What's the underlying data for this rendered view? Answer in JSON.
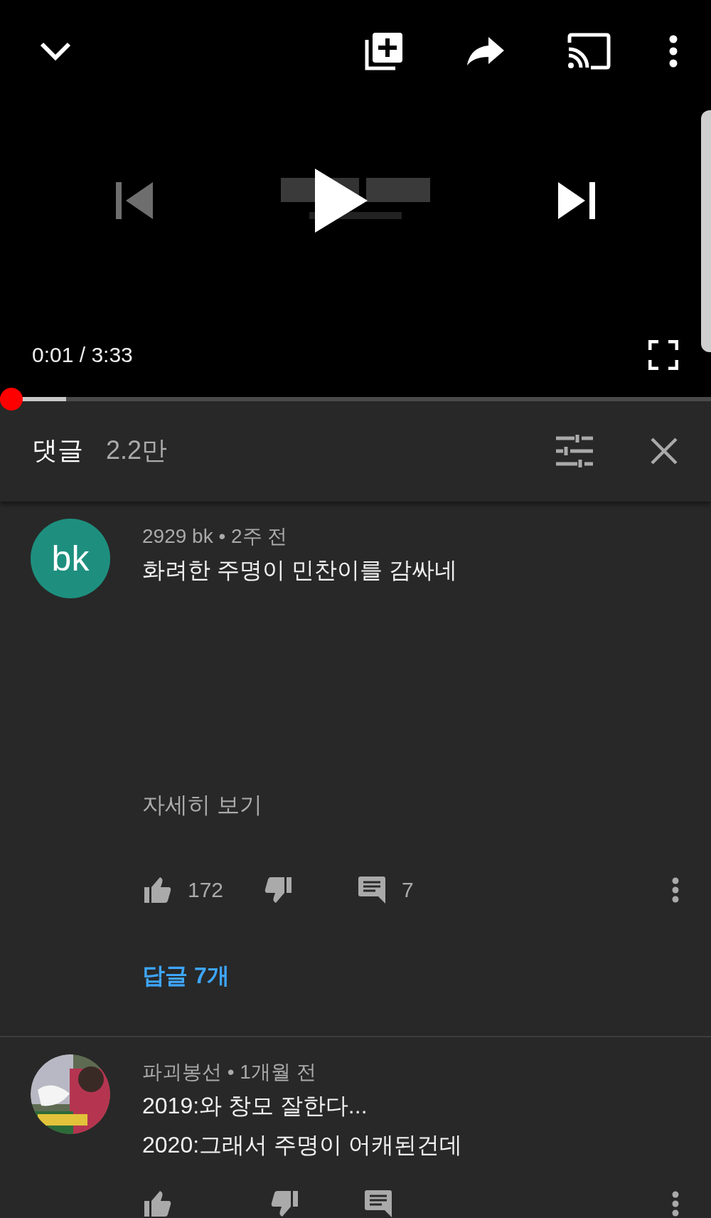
{
  "player": {
    "time": "0:01 / 3:33",
    "played": {
      "level": 0.016
    },
    "buffered": {
      "level": 0.093
    }
  },
  "comments_header": {
    "title": "댓글",
    "count": "2.2만"
  },
  "comments": [
    {
      "meta": "2929 bk • 2주 전",
      "avatar": {
        "kind": "initials",
        "text": "bk",
        "color": "#1e8f7f"
      },
      "lines": [
        "화려한 주명이 민찬이를 감싸네"
      ],
      "read_more": "자세히 보기",
      "likes": "172",
      "reply_count": "7",
      "replies_link": "답글 7개"
    },
    {
      "meta": "파괴봉선 • 1개월 전",
      "lines": [
        "2019:와 창모 잘한다...",
        "2020:그래서 주명이 어캐된건데"
      ]
    }
  ]
}
